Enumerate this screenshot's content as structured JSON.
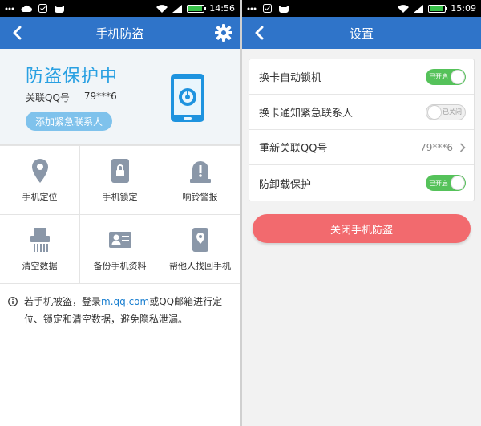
{
  "colors": {
    "titlebar": "#2f74c9",
    "accent_blue": "#29a0e2",
    "toggle_on": "#55c25a",
    "danger": "#f26a6e",
    "link": "#1a7fd0"
  },
  "left": {
    "status_bar": {
      "time": "14:56"
    },
    "title": "手机防盗",
    "hero": {
      "status": "防盗保护中",
      "account_label": "关联QQ号",
      "account_value": "79***6",
      "add_contact": "添加紧急联系人"
    },
    "grid": [
      {
        "label": "手机定位",
        "icon": "location-pin-icon"
      },
      {
        "label": "手机锁定",
        "icon": "phone-lock-icon"
      },
      {
        "label": "响铃警报",
        "icon": "alarm-bell-icon"
      },
      {
        "label": "清空数据",
        "icon": "shredder-icon"
      },
      {
        "label": "备份手机资料",
        "icon": "contact-card-icon"
      },
      {
        "label": "帮他人找回手机",
        "icon": "phone-location-icon"
      }
    ],
    "notice": {
      "before": "若手机被盗，登录",
      "link": "m.qq.com",
      "after": "或QQ邮箱进行定位、锁定和清空数据，避免隐私泄漏。"
    }
  },
  "right": {
    "status_bar": {
      "time": "15:09"
    },
    "title": "设置",
    "settings": [
      {
        "label": "换卡自动锁机",
        "type": "toggle",
        "state": "on",
        "state_text": "已开启"
      },
      {
        "label": "换卡通知紧急联系人",
        "type": "toggle",
        "state": "off",
        "state_text": "已关闭"
      },
      {
        "label": "重新关联QQ号",
        "type": "link",
        "value": "79***6"
      },
      {
        "label": "防卸载保护",
        "type": "toggle",
        "state": "on",
        "state_text": "已开启"
      }
    ],
    "close_button": "关闭手机防盗"
  }
}
